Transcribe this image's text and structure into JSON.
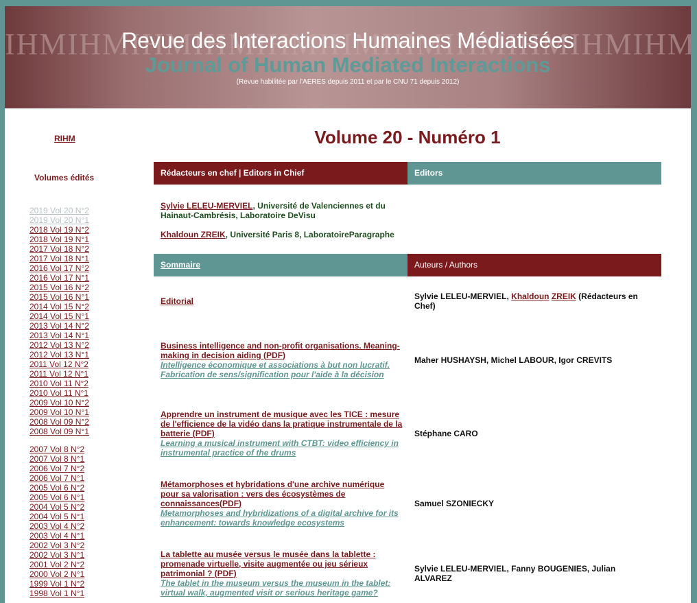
{
  "banner": {
    "watermark": "IHMIHMIHMIHMIHMIHMIHMIHMIHMIHMIHMIHMIHMIHMIHM",
    "title": "Revue des Interactions Humaines Médiatisées",
    "subtitle": "Journal of Human Mediated Interactions",
    "note": "(Revue habilitée par l'AERES depuis 2011 et par le CNU 71 depuis 2012)"
  },
  "sidebar": {
    "home_link": "RIHM",
    "volumes_heading": "Volumes édités",
    "volumes": [
      "2019 Vol 20 N°2",
      "2019 Vol 20 N°1",
      "2018 Vol 19 N°2",
      "2018 Vol 19 N°1",
      "2017 Vol 18 N°2",
      "2017 Vol 18 N°1",
      "2016 Vol 17 N°2",
      "2016 Vol 17 N°1",
      "2015 Vol 16 N°2",
      "2015 Vol 16 N°1",
      "2014 Vol 15 N°2",
      "2014 Vol 15 N°1",
      "2013 Vol 14 N°2",
      "2013 Vol 14 N°1",
      "2012 Vol 13 N°2",
      "2012 Vol 13 N°1",
      "2011 Vol 12 N°2",
      "2011 Vol 12 N°1",
      "2010 Vol 11 N°2",
      "2010 Vol 11 N°1",
      "2009 Vol 10 N°2",
      "2009 Vol 10 N°1",
      "2008 Vol 09 N°2",
      "2008 Vol 09 N°1",
      "2007 Vol 8 N°2",
      "2007 Vol 8 N°1",
      "2006 Vol 7 N°2",
      "2006 Vol 7 N°1",
      "2005 Vol 6 N°2",
      "2005 Vol 6 N°1",
      "2004 Vol 5 N°2",
      "2004 Vol 5 N°1",
      "2003 Vol 4 N°2",
      "2003 Vol 4 N°1",
      "2002 Vol 3 N°2",
      "2002 Vol 3 N°1",
      "2001 Vol 2 N°2",
      "2000 Vol 2 N°1",
      "1999 Vol 1 N°2",
      "1998 Vol 1 N°1"
    ]
  },
  "main": {
    "title": "Volume 20 - Numéro 1",
    "editors_in_chief_header": "Rédacteurs en chef | Editors in Chief",
    "editors_header": "Editors",
    "editors_in_chief": [
      {
        "name": "Sylvie LELEU-MERVIEL",
        "affiliation": ", Université de Valenciennes et du Hainaut-Cambrésis, Laboratoire DeVisu"
      },
      {
        "name": "Khaldoun ZREIK",
        "affiliation": ", Université Paris 8, LaboratoireParagraphe"
      }
    ],
    "summary_header": "Sommaire",
    "authors_header": "Auteurs / Authors",
    "articles": [
      {
        "title_fr": "Editorial",
        "pdf": "",
        "title_en": "",
        "authors_plain": "Sylvie LELEU-MERVIEL, ",
        "authors_link1": "Khaldoun",
        "authors_link2": "ZREIK",
        "authors_suffix": " (Rédacteurs en Chef)"
      },
      {
        "title_fr": "Business intelligence and non-profit organisations. Meaning-making in decision aiding (",
        "pdf": "PDF",
        "title_en": "Intelligence économique et associations à but non lucratif. Fabrication de sens/signification pour l'aide à la décision",
        "authors": "Maher HUSHAYSH, Michel LABOUR, Igor CREVITS"
      },
      {
        "title_fr": "Apprendre un instrument de musique avec les TICE : mesure de l'efficience de la vidéo dans la pratique instrumentale de la batterie (",
        "pdf": "PDF",
        "title_en": "Learning a musical instrument with CTBT: video efficiency in instrumental practice of the drums",
        "authors": "Stéphane CARO"
      },
      {
        "title_fr": "Métamorphoses et hybridations d'une archive numérique pour sa valorisation : vers des écosystèmes de connaissances(",
        "pdf": "PDF",
        "title_en": "Metamorphoses and hybridizations of a digital archive for its enhancement: towards knowledge ecosystems",
        "authors": "Samuel SZONIECKY"
      },
      {
        "title_fr": "La tablette au musée versus le musée dans la tablette : promenade virtuelle, visite augmentée ou jeu sérieux patrimonial ? (",
        "pdf": "PDF",
        "title_en": "The tablet in the museum versus the museum in the tablet: virtual walk, augmented visit or serious heritage game?",
        "authors": "Sylvie LELEU-MERVIEL, Fanny BOUGENIES, Julian ALVAREZ"
      }
    ]
  }
}
